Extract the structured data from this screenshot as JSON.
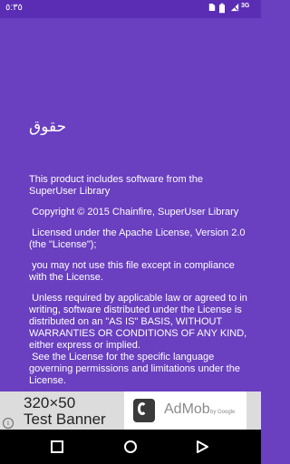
{
  "status_bar": {
    "time": "٥:٣٥",
    "network_label": "3G",
    "icons": [
      "sim-icon",
      "battery-icon",
      "no-signal-icon"
    ]
  },
  "license_screen": {
    "title": "حقوق",
    "paragraphs": [
      "This product includes software from the SuperUser Library",
      " Copyright © 2015 Chainfire, SuperUser Library",
      " Licensed under the Apache License, Version 2.0 (the \"License\");",
      " you may not use this file except in compliance with the License.",
      " Unless required by applicable law or agreed to in writing, software distributed under the License is distributed on an \"AS IS\" BASIS, WITHOUT WARRANTIES OR CONDITIONS OF ANY KIND, either express or implied.\n See the License for the specific language governing permissions and limitations under the License."
    ]
  },
  "ad_banner": {
    "title": "320×50",
    "subtitle": "Test Banner",
    "brand": "AdMob",
    "brand_suffix": "by Google",
    "info_glyph": "i",
    "colors": {
      "background": "#dcdcdc",
      "card": "#ffffff"
    }
  },
  "nav_bar": {
    "buttons": [
      "recents-button",
      "home-button",
      "back-button"
    ]
  },
  "colors": {
    "primary": "#6a3fc0",
    "status_bar": "#5a2db4",
    "nav_bar": "#000000"
  }
}
